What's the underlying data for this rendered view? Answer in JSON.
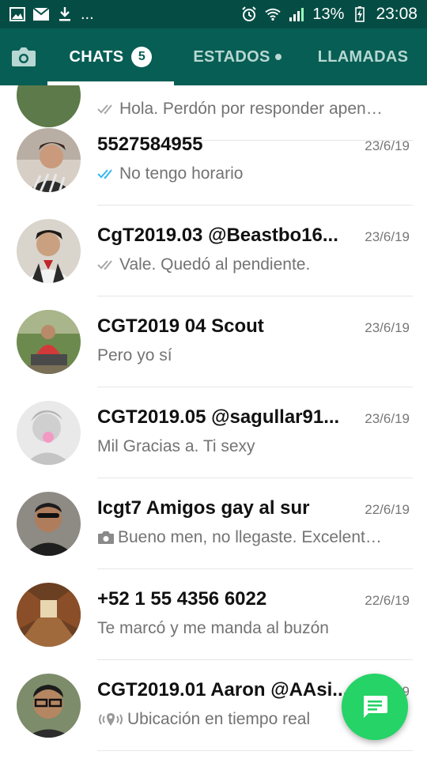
{
  "status_bar": {
    "left_icons": [
      "image-icon",
      "mail-icon",
      "download-icon"
    ],
    "more": "...",
    "battery_percent": "13%",
    "time": "23:08"
  },
  "tabs": [
    {
      "label": "CHATS",
      "badge": "5",
      "active": true
    },
    {
      "label": "ESTADOS",
      "has_dot": true,
      "active": false
    },
    {
      "label": "LLAMADAS",
      "active": false
    }
  ],
  "partial_row": {
    "preview": "Hola. Perdón por responder apen…"
  },
  "chats": [
    {
      "name": "5527584955",
      "date": "23/6/19",
      "preview": "No tengo horario",
      "status": "read",
      "avatar_color": "#6b4a3a"
    },
    {
      "name": "CgT2019.03 @Beastbo16...",
      "date": "23/6/19",
      "preview": "Vale. Quedó al pendiente.",
      "status": "delivered",
      "avatar_color": "#8a6f5c"
    },
    {
      "name": "CGT2019 04 Scout",
      "date": "23/6/19",
      "preview": "Pero yo sí",
      "status": "none",
      "avatar_color": "#4e6b3a"
    },
    {
      "name": "CGT2019.05 @sagullar91...",
      "date": "23/6/19",
      "preview": "Mil Gracias a. Ti sexy",
      "status": "none",
      "avatar_color": "#c9c9c9"
    },
    {
      "name": "Icgt7 Amigos gay al sur",
      "date": "22/6/19",
      "preview": "Bueno men, no llegaste. Excelent…",
      "status": "photo",
      "avatar_color": "#3a3530"
    },
    {
      "name": "+52 1 55 4356 6022",
      "date": "22/6/19",
      "preview": "Te marcó y me manda al buzón",
      "status": "none",
      "avatar_color": "#8a5a3a"
    },
    {
      "name": "CGT2019.01 Aaron @AAsi...",
      "date": "22/6/19",
      "preview": "Ubicación en tiempo real",
      "status": "location",
      "avatar_color": "#5a6a50"
    }
  ],
  "colors": {
    "header": "#075e54",
    "status_bar": "#054d44",
    "fab": "#25d366",
    "read_tick": "#34b7f1",
    "gray_tick": "#a8a8a8"
  }
}
